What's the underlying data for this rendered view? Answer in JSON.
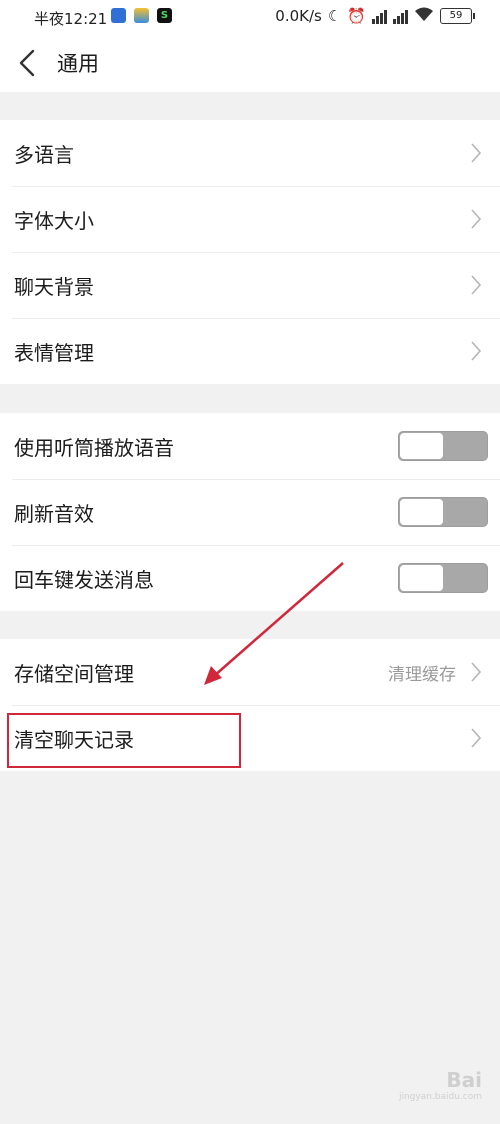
{
  "statusbar": {
    "time": "半夜12:21",
    "network_speed": "0.0K/s",
    "battery": "59"
  },
  "header": {
    "title": "通用"
  },
  "groups": [
    {
      "items": [
        {
          "label": "多语言"
        },
        {
          "label": "字体大小"
        },
        {
          "label": "聊天背景"
        },
        {
          "label": "表情管理"
        }
      ]
    },
    {
      "items": [
        {
          "label": "使用听筒播放语音",
          "toggle_on": false
        },
        {
          "label": "刷新音效",
          "toggle_on": false
        },
        {
          "label": "回车键发送消息",
          "toggle_on": false
        }
      ]
    },
    {
      "items": [
        {
          "label": "存储空间管理",
          "value": "清理缓存"
        },
        {
          "label": "清空聊天记录"
        }
      ]
    }
  ],
  "annotation": {
    "highlight_color": "#d0273a"
  },
  "watermark": {
    "text": "Bai",
    "sub": "jingyan.baidu.com"
  }
}
